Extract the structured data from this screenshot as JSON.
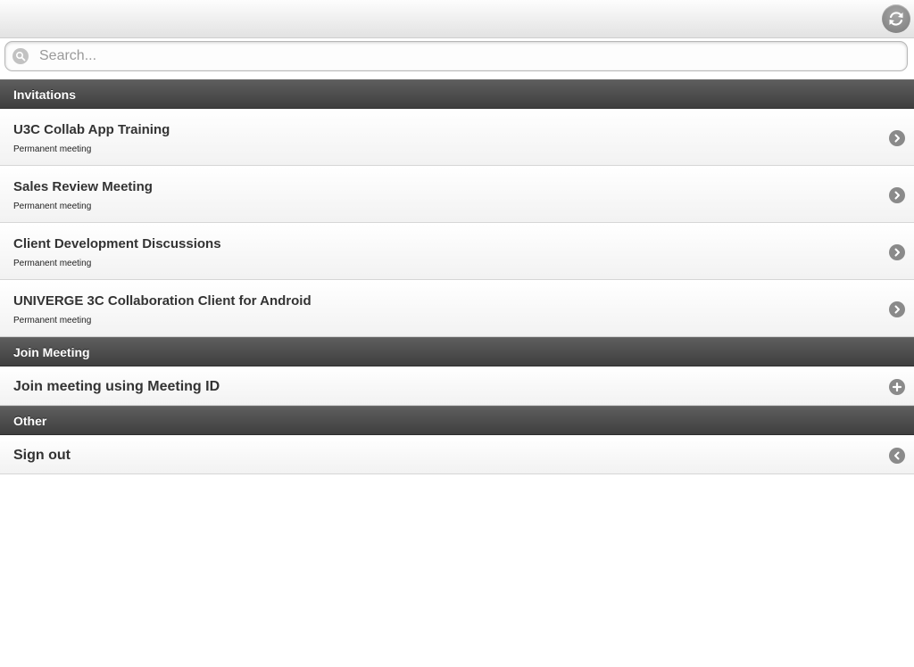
{
  "header": {
    "refresh_icon": "refresh-icon"
  },
  "search": {
    "placeholder": "Search...",
    "icon": "search-icon"
  },
  "sections": {
    "invitations": {
      "title": "Invitations",
      "items": [
        {
          "title": "U3C Collab App Training",
          "subtitle": "Permanent meeting",
          "icon": "chevron-right-icon"
        },
        {
          "title": "Sales Review Meeting",
          "subtitle": "Permanent meeting",
          "icon": "chevron-right-icon"
        },
        {
          "title": "Client Development Discussions",
          "subtitle": "Permanent meeting",
          "icon": "chevron-right-icon"
        },
        {
          "title": "UNIVERGE 3C Collaboration Client for Android",
          "subtitle": "Permanent meeting",
          "icon": "chevron-right-icon"
        }
      ]
    },
    "join_meeting": {
      "title": "Join Meeting",
      "items": [
        {
          "title": "Join meeting using Meeting ID",
          "icon": "plus-icon"
        }
      ]
    },
    "other": {
      "title": "Other",
      "items": [
        {
          "title": "Sign out",
          "icon": "chevron-left-icon"
        }
      ]
    }
  }
}
